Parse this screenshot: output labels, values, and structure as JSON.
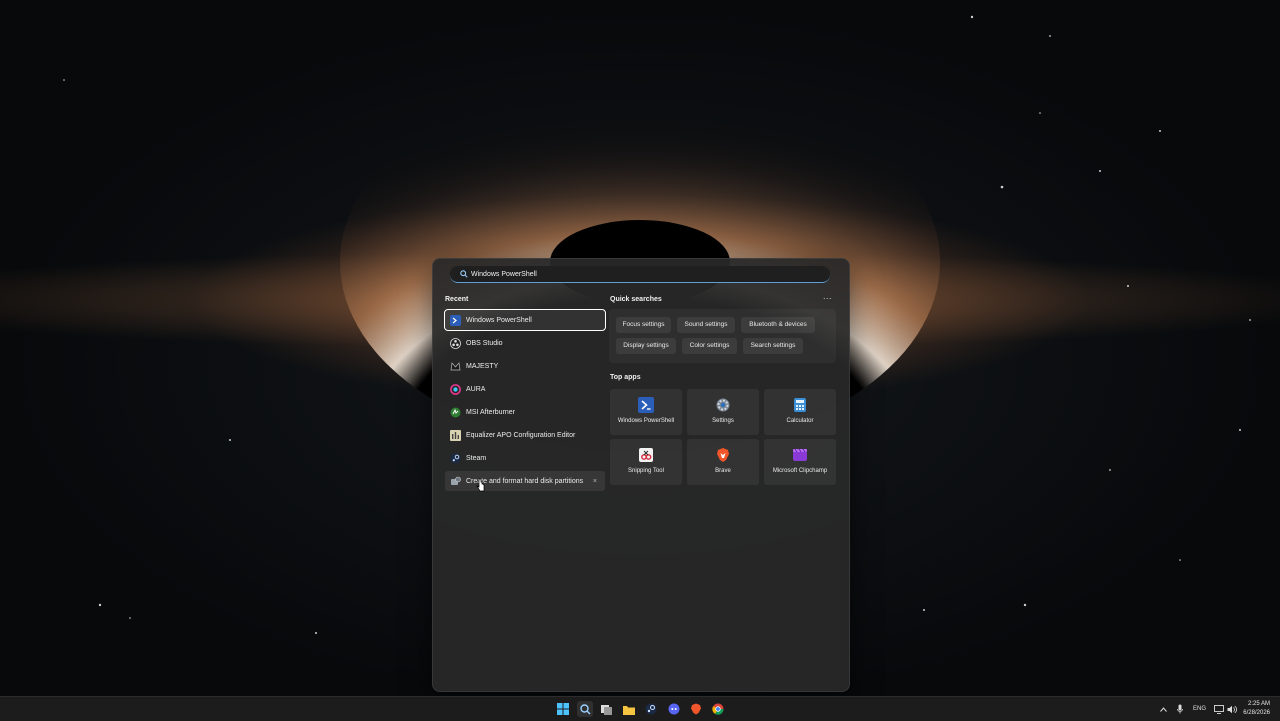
{
  "search": {
    "value": "Windows PowerShell"
  },
  "recent": {
    "title": "Recent",
    "items": [
      {
        "label": "Windows PowerShell",
        "icon": "powershell-icon"
      },
      {
        "label": "OBS Studio",
        "icon": "obs-icon"
      },
      {
        "label": "MAJESTY",
        "icon": "majesty-icon"
      },
      {
        "label": "AURA",
        "icon": "aura-icon"
      },
      {
        "label": "MSI Afterburner",
        "icon": "msi-afterburner-icon"
      },
      {
        "label": "Equalizer APO Configuration Editor",
        "icon": "equalizer-icon"
      },
      {
        "label": "Steam",
        "icon": "steam-icon"
      },
      {
        "label": "Create and format hard disk partitions",
        "icon": "disk-management-icon",
        "remove": "×"
      }
    ]
  },
  "quick_searches": {
    "title": "Quick searches",
    "more": "...",
    "chips": [
      "Focus settings",
      "Sound settings",
      "Bluetooth & devices",
      "Display settings",
      "Color settings",
      "Search settings"
    ]
  },
  "top_apps": {
    "title": "Top apps",
    "apps": [
      {
        "label": "Windows PowerShell",
        "icon": "powershell-icon"
      },
      {
        "label": "Settings",
        "icon": "settings-gear-icon"
      },
      {
        "label": "Calculator",
        "icon": "calculator-icon"
      },
      {
        "label": "Snipping Tool",
        "icon": "snipping-tool-icon"
      },
      {
        "label": "Brave",
        "icon": "brave-icon"
      },
      {
        "label": "Microsoft Clipchamp",
        "icon": "clipchamp-icon"
      }
    ]
  },
  "taskbar": {
    "apps": [
      "windows-start-icon",
      "search-icon",
      "task-view-icon",
      "file-explorer-icon",
      "steam-icon",
      "discord-icon",
      "brave-icon",
      "chrome-icon"
    ],
    "tray": {
      "lang": "ENG",
      "time": "2:25 AM",
      "date": "6/28/2026"
    }
  },
  "colors": {
    "accent": "#5e9fd6",
    "panel": "#282828",
    "taskbar": "#1c1c1c"
  }
}
